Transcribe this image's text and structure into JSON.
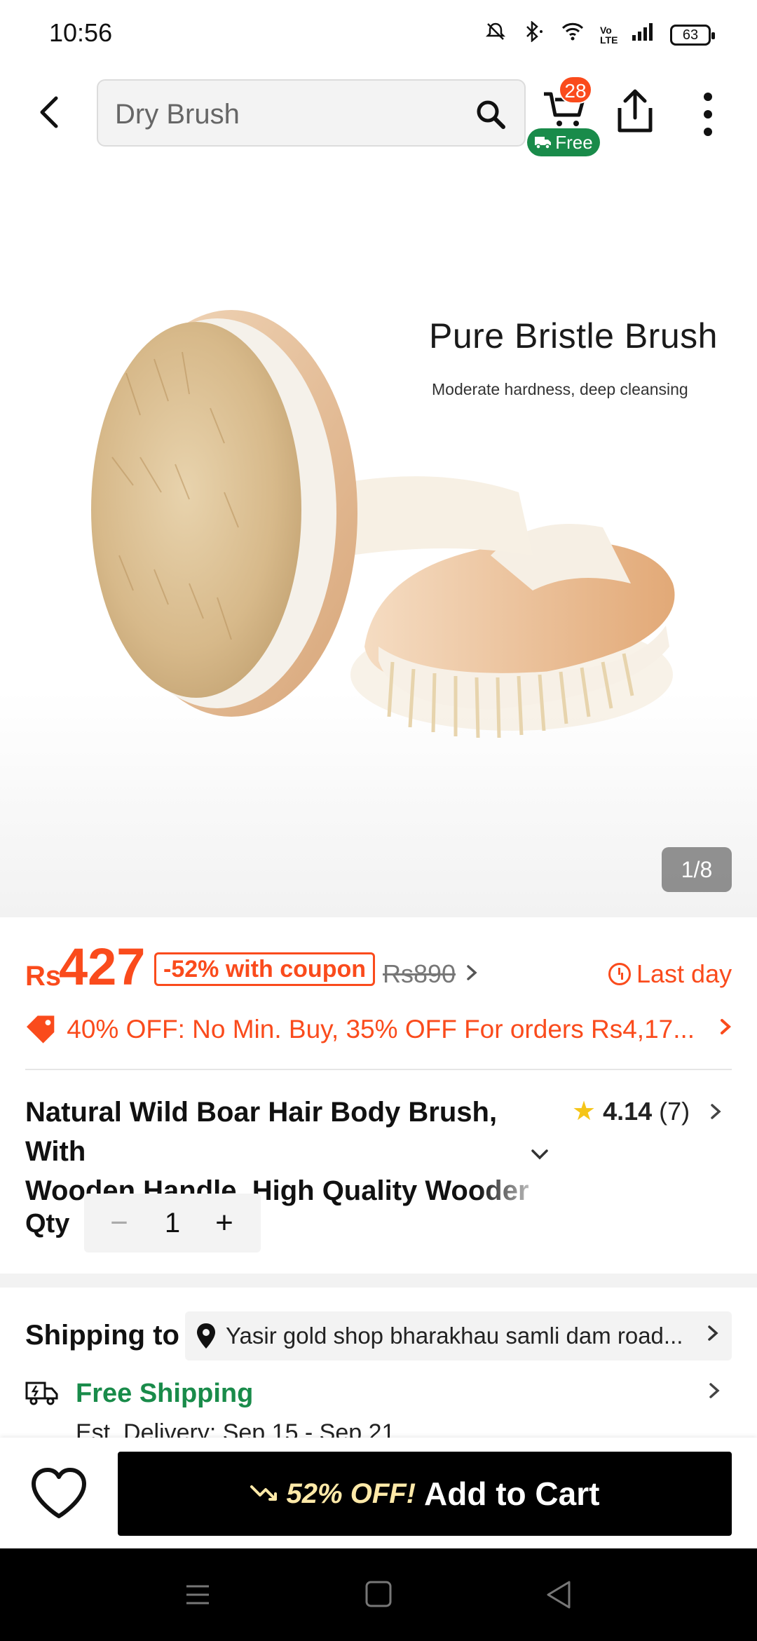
{
  "status_bar": {
    "time": "10:56",
    "signal_label": "Vo LTE",
    "battery": "63"
  },
  "header": {
    "search_value": "Dry Brush",
    "cart_count": "28",
    "free_badge": "Free"
  },
  "hero": {
    "title": "Pure Bristle Brush",
    "subtitle": "Moderate hardness, deep cleansing",
    "pager": "1/8"
  },
  "price": {
    "currency": "Rs",
    "current": "427",
    "coupon": "-52% with coupon",
    "original": "Rs890",
    "deadline": "Last day"
  },
  "promo": {
    "text": "40% OFF: No Min. Buy,  35% OFF For orders Rs4,17..."
  },
  "product": {
    "title_line1": "Natural Wild Boar Hair Body Brush, With",
    "title_line2_a": "Wooden Handle, High Quality ",
    "title_line2_b": "Wooder",
    "rating": "4.14",
    "rating_count": "(7)"
  },
  "qty": {
    "label": "Qty",
    "value": "1",
    "minus": "−",
    "plus": "+"
  },
  "shipping": {
    "label": "Shipping to",
    "address": "Yasir gold shop bharakhau samli dam road...",
    "free_shipping": "Free Shipping",
    "estimate": "Est. Delivery: Sep 15 - Sep 21"
  },
  "bottom": {
    "discount": "52% OFF!",
    "add_to_cart": "Add to Cart"
  },
  "colors": {
    "accent": "#fa4b1c",
    "green": "#198b4a",
    "black": "#000000"
  }
}
